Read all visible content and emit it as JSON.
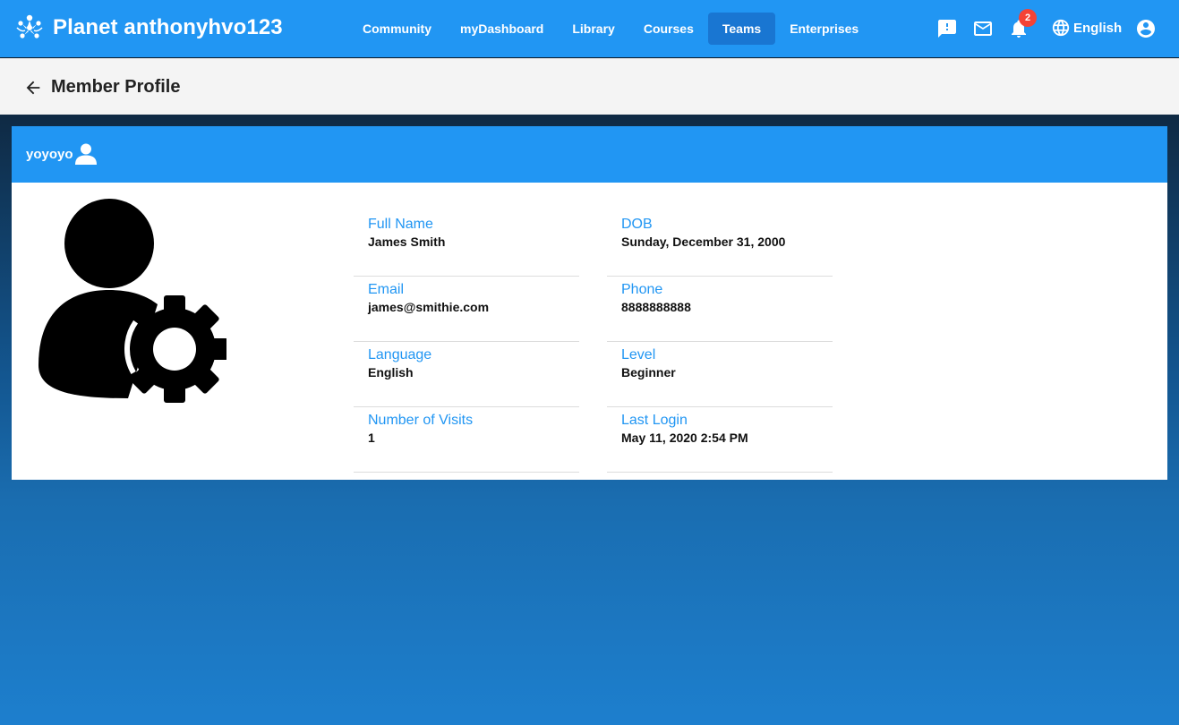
{
  "app": {
    "title": "Planet anthonyhvo123"
  },
  "nav": {
    "items": [
      {
        "label": "Community"
      },
      {
        "label": "myDashboard"
      },
      {
        "label": "Library"
      },
      {
        "label": "Courses"
      },
      {
        "label": "Teams"
      },
      {
        "label": "Enterprises"
      }
    ]
  },
  "toolbar": {
    "notification_count": "2",
    "language": "English"
  },
  "page": {
    "title": "Member Profile"
  },
  "profile": {
    "username": "yoyoyo",
    "fields": [
      {
        "label": "Full Name",
        "value": "James Smith"
      },
      {
        "label": "DOB",
        "value": "Sunday, December 31, 2000"
      },
      {
        "label": "Email",
        "value": "james@smithie.com"
      },
      {
        "label": "Phone",
        "value": "8888888888"
      },
      {
        "label": "Language",
        "value": "English"
      },
      {
        "label": "Level",
        "value": "Beginner"
      },
      {
        "label": "Number of Visits",
        "value": "1"
      },
      {
        "label": "Last Login",
        "value": "May 11, 2020 2:54 PM"
      }
    ]
  },
  "colors": {
    "primary": "#2196f3",
    "primary_dark": "#1976d2",
    "badge": "#f44336"
  }
}
